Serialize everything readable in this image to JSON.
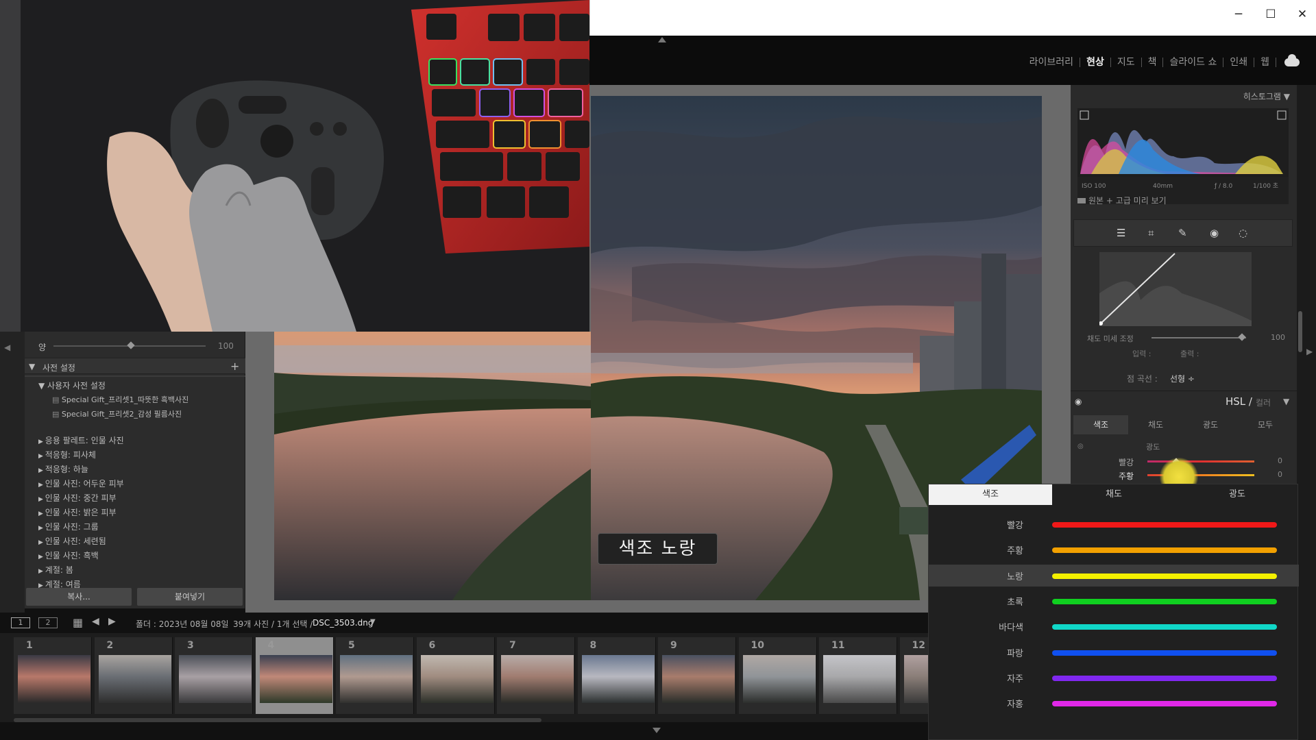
{
  "window": {
    "minimize": "─",
    "maximize": "☐",
    "close": "✕"
  },
  "modules": [
    "라이브러리",
    "현상",
    "지도",
    "책",
    "슬라이드 쇼",
    "인쇄",
    "웹"
  ],
  "active_module": "현상",
  "histogram": {
    "title": "히스토그램",
    "iso": "ISO 100",
    "focal": "40mm",
    "aperture": "ƒ / 8.0",
    "shutter": "1/100 초",
    "preview_label": "원본 + 고급 미리 보기"
  },
  "tone_curve": {
    "saturation_label": "채도 미세 조정",
    "saturation_value": "100",
    "input_label": "입력 :",
    "output_label": "출력 :",
    "point_curve_label": "점 곡선 :",
    "point_curve_value": "선형 ÷"
  },
  "hsl_panel": {
    "title": "HSL /",
    "title_dim": "컬러",
    "tabs": [
      "색조",
      "채도",
      "광도",
      "모두"
    ],
    "section": "광도",
    "rows": [
      {
        "label": "빨강",
        "value": "0"
      },
      {
        "label": "주황",
        "value": "0"
      }
    ]
  },
  "left_panel": {
    "slider_label": "양",
    "slider_value": "100",
    "presets_title": "사전 설정",
    "add": "+",
    "user_group": "사용자 사전 설정",
    "user_items": [
      "Special Gift_프리셋1_따뜻한 흑백사진",
      "Special Gift_프리셋2_감성 필름사진"
    ],
    "groups": [
      "응용 팔레트: 인물 사진",
      "적응형: 피사체",
      "적응형: 하늘",
      "인물 사진: 어두운 피부",
      "인물 사진: 중간 피부",
      "인물 사진: 밝은 피부",
      "인물 사진: 그룹",
      "인물 사진: 세련됨",
      "인물 사진: 흑백",
      "계절: 봄",
      "계절: 여름"
    ],
    "copy_button": "복사...",
    "paste_button": "붙여넣기"
  },
  "caption": "색조 노랑",
  "filmbar": {
    "view1": "1",
    "view2": "2",
    "folder": "폴더 : 2023년 08월 08일",
    "count": "39개 사진 / 1개 선택 /",
    "filename": "DSC_3503.dng"
  },
  "thumbnails": [
    "1",
    "2",
    "3",
    "4",
    "5",
    "6",
    "7",
    "8",
    "9",
    "10",
    "11",
    "12"
  ],
  "selected_thumbnail": "4",
  "hsl_overlay": {
    "tabs": [
      "색조",
      "채도",
      "광도"
    ],
    "active_tab": "색조",
    "rows": [
      {
        "label": "빨강",
        "color": "#f01818"
      },
      {
        "label": "주황",
        "color": "#f2a000"
      },
      {
        "label": "노랑",
        "color": "#f4f000"
      },
      {
        "label": "초록",
        "color": "#10d020"
      },
      {
        "label": "바다색",
        "color": "#10d8c8"
      },
      {
        "label": "파랑",
        "color": "#1050f0"
      },
      {
        "label": "자주",
        "color": "#8028f0"
      },
      {
        "label": "자홍",
        "color": "#e028e8"
      }
    ],
    "selected_row": "노랑"
  }
}
